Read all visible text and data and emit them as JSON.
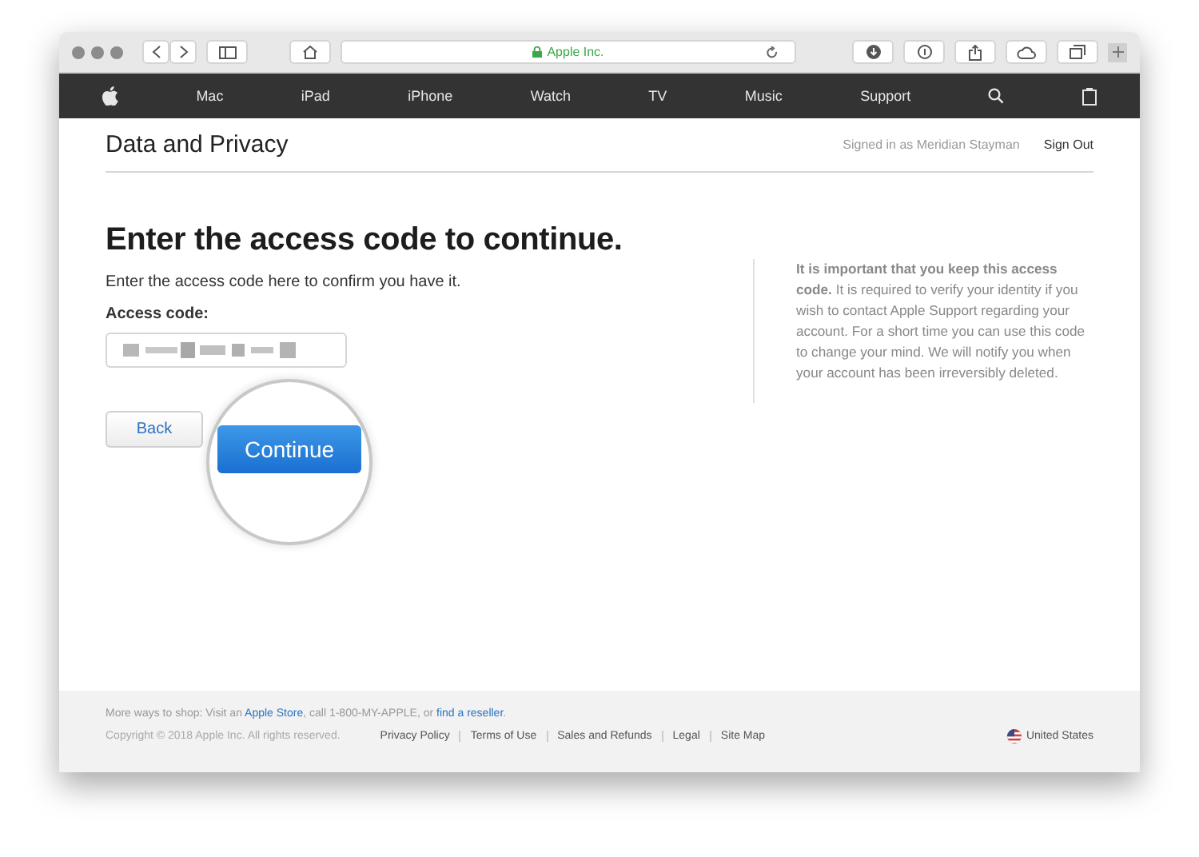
{
  "browser": {
    "address": "Apple Inc."
  },
  "nav": {
    "items": [
      "Mac",
      "iPad",
      "iPhone",
      "Watch",
      "TV",
      "Music",
      "Support"
    ]
  },
  "header": {
    "title": "Data and Privacy",
    "signed_in": "Signed in as Meridian Stayman",
    "sign_out": "Sign Out"
  },
  "main": {
    "heading": "Enter the access code to continue.",
    "instruction": "Enter the access code here to confirm you have it.",
    "field_label": "Access code:",
    "back": "Back",
    "continue": "Continue"
  },
  "note": {
    "text": "**It is important that you keep this access code.** It is required to verify your identity if you wish to contact Apple Support regarding your account. For a short time you can use this code to change your mind. We will notify you when your account has been irreversibly deleted."
  },
  "footer": {
    "shop_line": [
      {
        "text": "More ways to shop: Visit an ",
        "link": false
      },
      {
        "text": "Apple Store",
        "link": true
      },
      {
        "text": ", call 1-800-MY-APPLE, or ",
        "link": false
      },
      {
        "text": "find a reseller",
        "link": true
      },
      {
        "text": ".",
        "link": false
      }
    ],
    "copyright": "Copyright © 2018 Apple Inc. All rights reserved.",
    "links": [
      "Privacy Policy",
      "Terms of Use",
      "Sales and Refunds",
      "Legal",
      "Site Map"
    ],
    "region": "United States"
  }
}
